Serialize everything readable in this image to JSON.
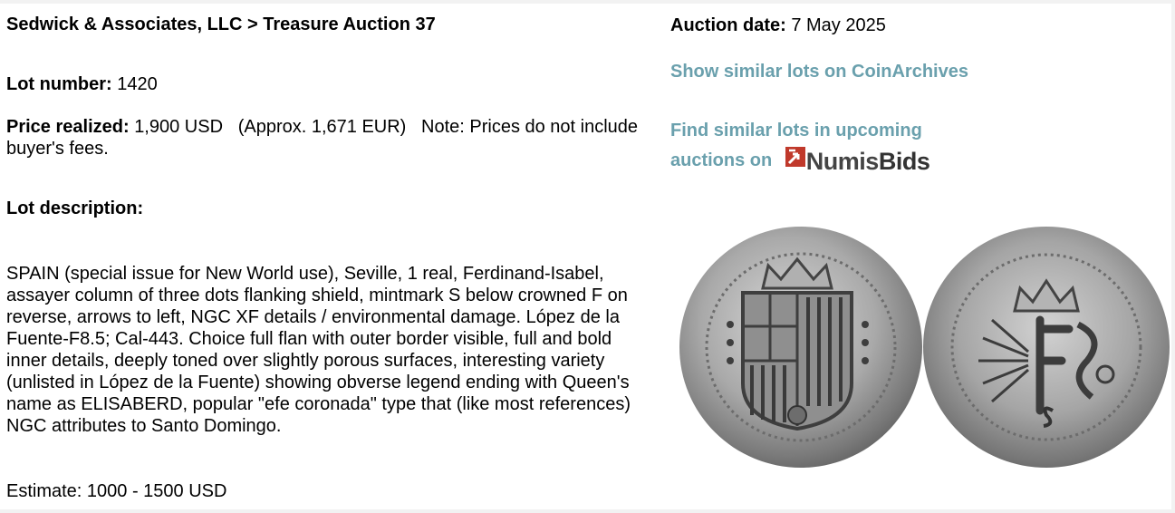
{
  "breadcrumb": {
    "auction_house": "Sedwick & Associates, LLC",
    "separator": ">",
    "auction": "Treasure Auction 37"
  },
  "lot_number": {
    "label": "Lot number:",
    "value": "1420"
  },
  "price": {
    "label": "Price realized:",
    "value": "1,900 USD",
    "approx": "(Approx. 1,671 EUR)",
    "note": "Note: Prices do not include buyer's fees."
  },
  "description": {
    "label": "Lot description:",
    "text": "SPAIN (special issue for New World use), Seville, 1 real, Ferdinand-Isabel, assayer column of three dots flanking shield, mintmark S below crowned F on reverse, arrows to left, NGC XF details / environmental damage. López de la Fuente-F8.5; Cal-443. Choice full flan with outer border visible, full and bold inner details, deeply toned over slightly porous surfaces, interesting variety (unlisted in López de la Fuente) showing obverse legend ending with Queen's name as ELISABERD, popular \"efe coronada\" type that (like most references) NGC attributes to Santo Domingo."
  },
  "estimate": "Estimate: 1000 - 1500 USD",
  "auction_date": {
    "label": "Auction date:",
    "value": "7 May 2025"
  },
  "links": {
    "similar_coinarchives": "Show similar lots on CoinArchives",
    "find_upcoming": "Find similar lots in upcoming auctions on",
    "numisbids_logo_text": {
      "light": "Numis",
      "bold": "Bids"
    }
  },
  "colors": {
    "link": "#6aa0ad",
    "numisbids_red": "#c0392b",
    "coin_silver": "#b9b9b9"
  },
  "icons": [
    "numisbids-logo",
    "coin-obverse-image",
    "coin-reverse-image"
  ]
}
